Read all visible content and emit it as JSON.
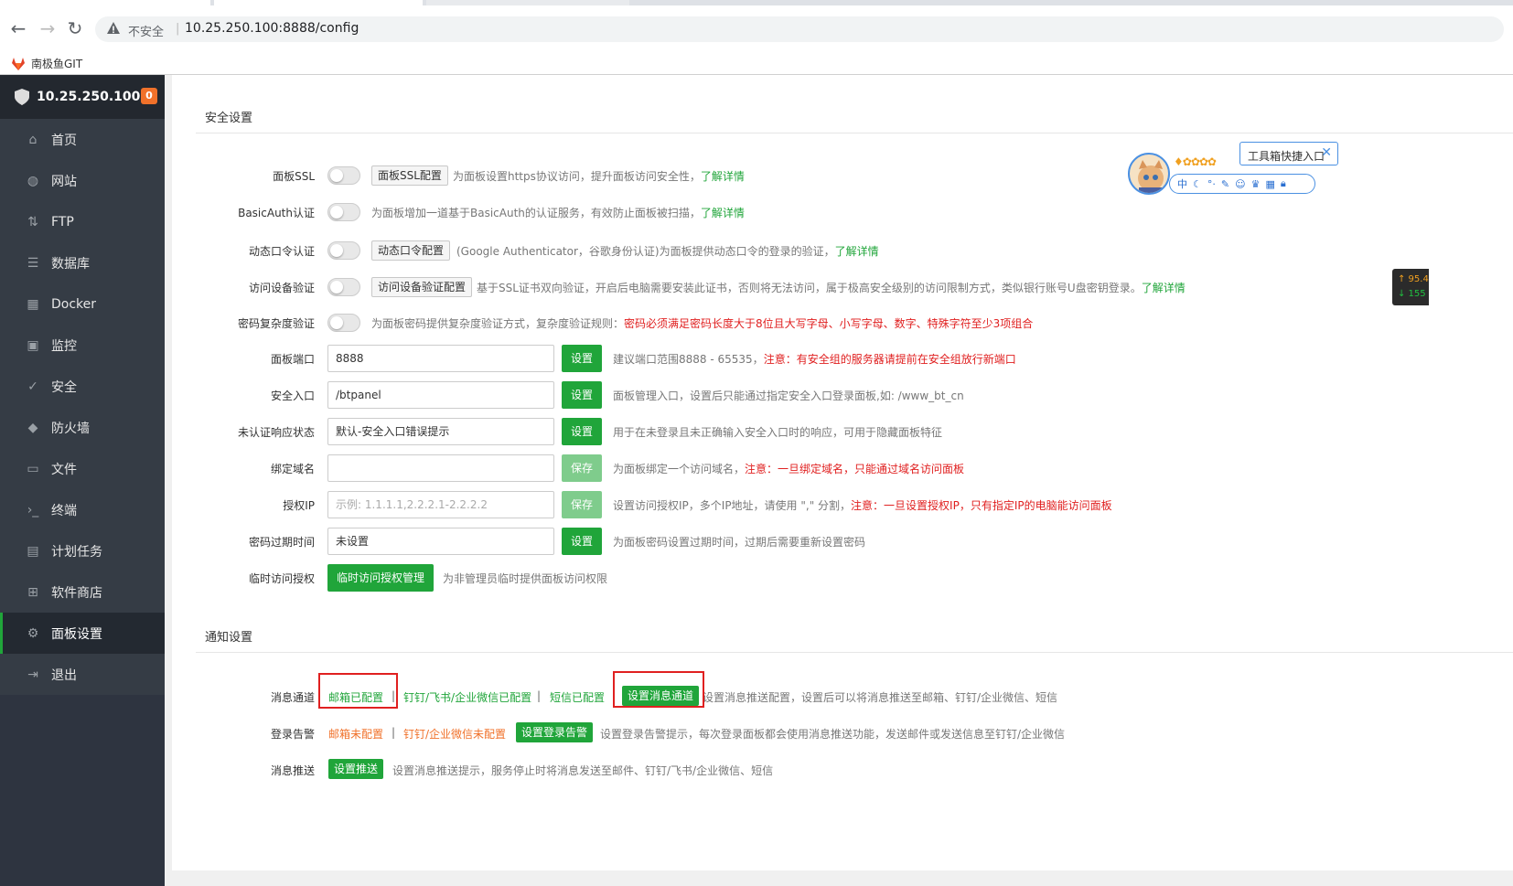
{
  "browser": {
    "security_text": "不安全",
    "url": "10.25.250.100:8888/config",
    "bookmark": "南极鱼GIT"
  },
  "sidebar": {
    "host": "10.25.250.100",
    "badge": "0",
    "items": [
      {
        "label": "首页",
        "icon": "home-icon"
      },
      {
        "label": "网站",
        "icon": "globe-icon"
      },
      {
        "label": "FTP",
        "icon": "ftp-icon"
      },
      {
        "label": "数据库",
        "icon": "database-icon"
      },
      {
        "label": "Docker",
        "icon": "docker-icon"
      },
      {
        "label": "监控",
        "icon": "monitor-icon"
      },
      {
        "label": "安全",
        "icon": "shield-check-icon"
      },
      {
        "label": "防火墙",
        "icon": "firewall-icon"
      },
      {
        "label": "文件",
        "icon": "folder-icon"
      },
      {
        "label": "终端",
        "icon": "terminal-icon"
      },
      {
        "label": "计划任务",
        "icon": "calendar-icon"
      },
      {
        "label": "软件商店",
        "icon": "apps-icon"
      },
      {
        "label": "面板设置",
        "icon": "gear-icon",
        "active": true
      },
      {
        "label": "退出",
        "icon": "logout-icon"
      }
    ]
  },
  "security": {
    "title": "安全设置",
    "ssl": {
      "label": "面板SSL",
      "btn": "面板SSL配置",
      "desc": "为面板设置https协议访问，提升面板访问安全性，",
      "link": "了解详情"
    },
    "basicauth": {
      "label": "BasicAuth认证",
      "desc": "为面板增加一道基于BasicAuth的认证服务，有效防止面板被扫描，",
      "link": "了解详情"
    },
    "otp": {
      "label": "动态口令认证",
      "btn": "动态口令配置",
      "desc": "(Google Authenticator，谷歌身份认证)为面板提供动态口令的登录的验证，",
      "link": "了解详情"
    },
    "device": {
      "label": "访问设备验证",
      "btn": "访问设备验证配置",
      "desc": "基于SSL证书双向验证，开启后电脑需要安装此证书，否则将无法访问，属于极高安全级别的访问限制方式，类似银行账号U盘密钥登录。",
      "link": "了解详情"
    },
    "pwdcomplex": {
      "label": "密码复杂度验证",
      "desc": "为面板密码提供复杂度验证方式，复杂度验证规则：",
      "em": "密码必须满足密码长度大于8位且大写字母、小写字母、数字、特殊字符至少3项组合"
    },
    "port": {
      "label": "面板端口",
      "value": "8888",
      "btn": "设置",
      "desc": "建议端口范围8888 - 65535，",
      "em": "注意：有安全组的服务器请提前在安全组放行新端口"
    },
    "entry": {
      "label": "安全入口",
      "value": "/btpanel",
      "btn": "设置",
      "desc": "面板管理入口，设置后只能通过指定安全入口登录面板,如: /www_bt_cn"
    },
    "unauth": {
      "label": "未认证响应状态",
      "value": "默认-安全入口错误提示",
      "btn": "设置",
      "desc": "用于在未登录且未正确输入安全入口时的响应，可用于隐藏面板特征"
    },
    "domain": {
      "label": "绑定域名",
      "value": "",
      "btn": "保存",
      "desc": "为面板绑定一个访问域名，",
      "em": "注意：一旦绑定域名，只能通过域名访问面板"
    },
    "ip": {
      "label": "授权IP",
      "placeholder": "示例: 1.1.1.1,2.2.2.1-2.2.2.2",
      "btn": "保存",
      "desc": "设置访问授权IP，多个IP地址，请使用 \",\" 分割，",
      "em": "注意：一旦设置授权IP，只有指定IP的电脑能访问面板"
    },
    "expire": {
      "label": "密码过期时间",
      "value": "未设置",
      "btn": "设置",
      "desc": "为面板密码设置过期时间，过期后需要重新设置密码"
    },
    "temp": {
      "label": "临时访问授权",
      "btn": "临时访问授权管理",
      "desc": "为非管理员临时提供面板访问权限"
    }
  },
  "notify": {
    "title": "通知设置",
    "channel": {
      "label": "消息通道",
      "mail": "邮箱已配置",
      "ding": "钉钉/飞书/企业微信已配置",
      "sms": "短信已配置",
      "btn": "设置消息通道",
      "desc": "设置消息推送配置，设置后可以将消息推送至邮箱、钉钉/企业微信、短信"
    },
    "login": {
      "label": "登录告警",
      "mail": "邮箱未配置",
      "ding": "钉钉/企业微信未配置",
      "btn": "设置登录告警",
      "desc": "设置登录告警提示，每次登录面板都会使用消息推送功能，发送邮件或发送信息至钉钉/企业微信"
    },
    "push": {
      "label": "消息推送",
      "btn": "设置推送",
      "desc": "设置消息推送提示，服务停止时将消息发送至邮件、钉钉/飞书/企业微信、短信"
    }
  },
  "widgets": {
    "toolbox_label": "工具箱快捷入口",
    "pill_char": "中",
    "speed_up": "↑ 95.4",
    "speed_down": "↓ 155"
  }
}
